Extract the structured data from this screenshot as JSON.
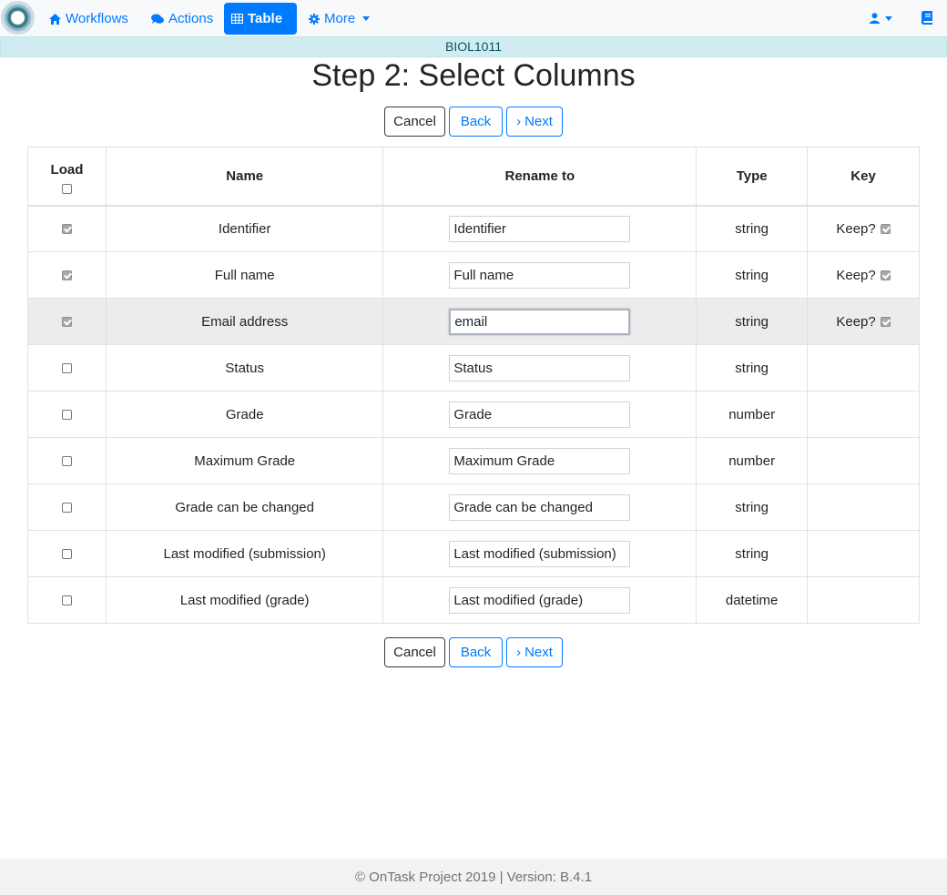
{
  "nav": {
    "items": [
      {
        "label": "Workflows",
        "icon": "home-icon"
      },
      {
        "label": "Actions",
        "icon": "comments-icon"
      },
      {
        "label": "Table",
        "icon": "table-icon"
      },
      {
        "label": "More",
        "icon": "gear-icon"
      }
    ],
    "active": "Table"
  },
  "workflow_name": "BIOL1011",
  "page_title": "Step 2: Select Columns",
  "buttons": {
    "cancel": "Cancel",
    "back": "Back",
    "next": "Next",
    "next_glyph": "›"
  },
  "table": {
    "headers": {
      "load": "Load",
      "name": "Name",
      "rename": "Rename to",
      "type": "Type",
      "key": "Key"
    },
    "keep_label": "Keep?",
    "rows": [
      {
        "name": "Identifier",
        "rename": "Identifier",
        "type": "string",
        "load": true,
        "key": true
      },
      {
        "name": "Full name",
        "rename": "Full name",
        "type": "string",
        "load": true,
        "key": true
      },
      {
        "name": "Email address",
        "rename": "email",
        "type": "string",
        "load": true,
        "key": true
      },
      {
        "name": "Status",
        "rename": "Status",
        "type": "string",
        "load": false,
        "key": false
      },
      {
        "name": "Grade",
        "rename": "Grade",
        "type": "number",
        "load": false,
        "key": false
      },
      {
        "name": "Maximum Grade",
        "rename": "Maximum Grade",
        "type": "number",
        "load": false,
        "key": false
      },
      {
        "name": "Grade can be changed",
        "rename": "Grade can be changed",
        "type": "string",
        "load": false,
        "key": false
      },
      {
        "name": "Last modified (submission)",
        "rename": "Last modified (submission)",
        "type": "string",
        "load": false,
        "key": false
      },
      {
        "name": "Last modified (grade)",
        "rename": "Last modified (grade)",
        "type": "datetime",
        "load": false,
        "key": false
      }
    ]
  },
  "footer": "© OnTask Project 2019 | Version: B.4.1",
  "colors": {
    "accent": "#007bff",
    "banner_bg": "#d1ecf1",
    "banner_text": "#0c5460"
  }
}
